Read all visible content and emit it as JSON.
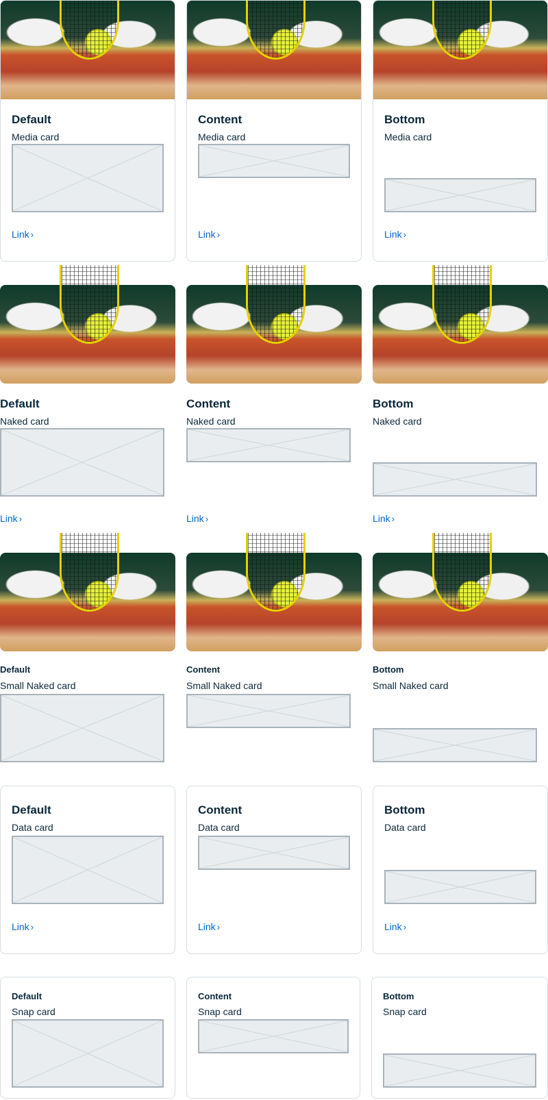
{
  "link_label": "Link",
  "chevron_glyph": "›",
  "rows": [
    {
      "subtitle": "Media card",
      "cards": [
        {
          "title": "Default"
        },
        {
          "title": "Content"
        },
        {
          "title": "Bottom"
        }
      ]
    },
    {
      "subtitle": "Naked card",
      "cards": [
        {
          "title": "Default"
        },
        {
          "title": "Content"
        },
        {
          "title": "Bottom"
        }
      ]
    },
    {
      "subtitle": "Small Naked card",
      "cards": [
        {
          "title": "Default"
        },
        {
          "title": "Content"
        },
        {
          "title": "Bottom"
        }
      ]
    },
    {
      "subtitle": "Data card",
      "cards": [
        {
          "title": "Default"
        },
        {
          "title": "Content"
        },
        {
          "title": "Bottom"
        }
      ]
    },
    {
      "subtitle": "Snap card",
      "cards": [
        {
          "title": "Default"
        },
        {
          "title": "Content"
        },
        {
          "title": "Bottom"
        }
      ]
    }
  ],
  "colors": {
    "link": "#0066cc",
    "title": "#0b2739",
    "border": "#d6dde2",
    "placeholder_fill": "#e9edef",
    "placeholder_stroke": "#a9b3ba"
  }
}
